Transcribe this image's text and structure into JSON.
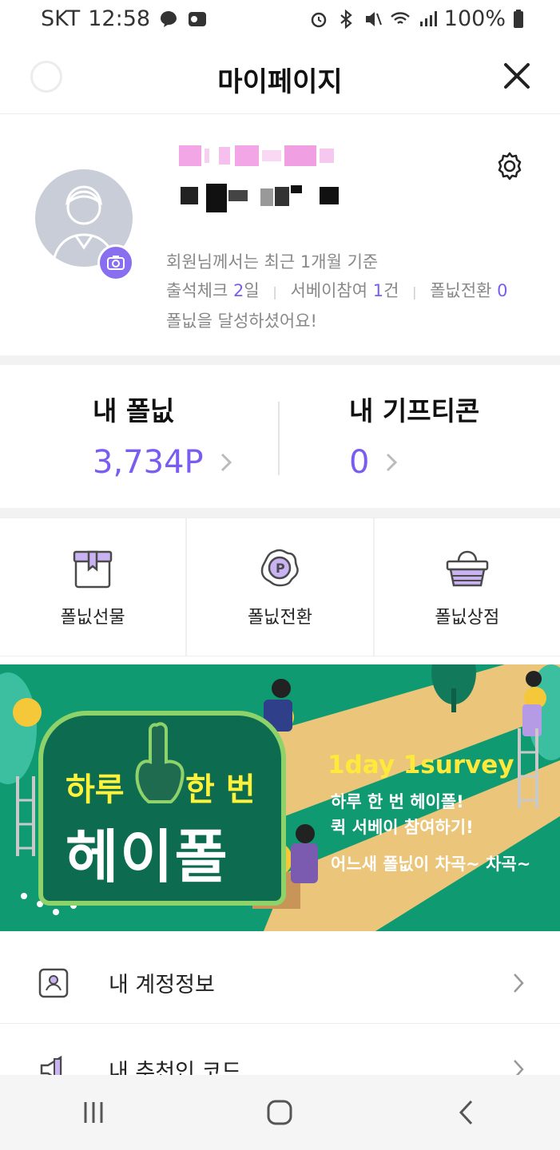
{
  "status_bar": {
    "carrier": "SKT",
    "time": "12:58",
    "battery": "100%"
  },
  "header": {
    "title": "마이페이지"
  },
  "profile": {
    "summary_line1": "회원님께서는 최근 1개월 기준",
    "stat_attend_label": "출석체크",
    "stat_attend_value": "2",
    "stat_attend_unit": "일",
    "stat_survey_label": "서베이참여",
    "stat_survey_value": "1",
    "stat_survey_unit": "건",
    "stat_exchange_label": "폴닚전환",
    "stat_exchange_value": "0",
    "summary_line3": "폴닚을 달성하셨어요!"
  },
  "points": {
    "my_points_label": "내 폴닚",
    "my_points_value": "3,734P",
    "my_gifticon_label": "내 기프티콘",
    "my_gifticon_value": "0"
  },
  "menu": {
    "gift": "폴닚선물",
    "exchange": "폴닚전환",
    "shop": "폴닚상점"
  },
  "banner": {
    "headline_left": "하루",
    "headline_right": "한 번",
    "brand": "헤이폴",
    "tagline": "1day 1survey",
    "line1": "하루 한 번 헤이폴!",
    "line2": "퀵 서베이 참여하기!",
    "line3": "어느새 폴닚이 차곡~ 차곡~"
  },
  "list": {
    "account_info": "내 계정정보",
    "referral_code": "내 추천인 코드"
  },
  "colors": {
    "accent": "#7a5cf0",
    "banner_green": "#0f9a72",
    "banner_yellow": "#ffe93a"
  }
}
